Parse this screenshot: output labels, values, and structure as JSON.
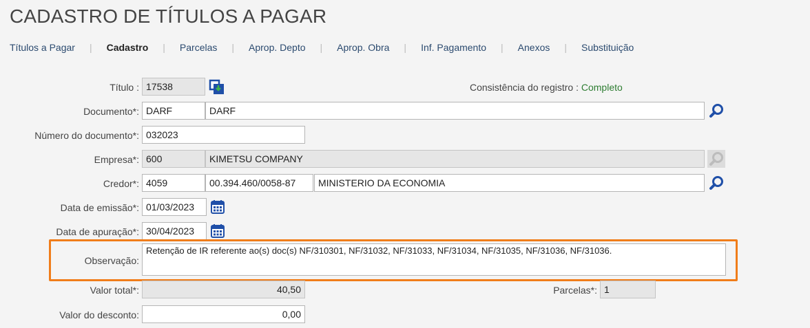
{
  "page": {
    "title": "CADASTRO DE TÍTULOS A PAGAR"
  },
  "tabs": [
    {
      "label": "Títulos a Pagar",
      "active": false
    },
    {
      "label": "Cadastro",
      "active": true
    },
    {
      "label": "Parcelas",
      "active": false
    },
    {
      "label": "Aprop. Depto",
      "active": false
    },
    {
      "label": "Aprop. Obra",
      "active": false
    },
    {
      "label": "Inf. Pagamento",
      "active": false
    },
    {
      "label": "Anexos",
      "active": false
    },
    {
      "label": "Substituição",
      "active": false
    }
  ],
  "tab_separator": "|",
  "form": {
    "titulo": {
      "label": "Título :",
      "value": "17538",
      "icon": "copy-record-icon"
    },
    "consistencia": {
      "label": "Consistência do registro :",
      "value": "Completo"
    },
    "documento": {
      "label": "Documento*:",
      "code": "DARF",
      "description": "DARF",
      "icon": "search-icon"
    },
    "numero_documento": {
      "label": "Número do documento*:",
      "value": "032023"
    },
    "empresa": {
      "label": "Empresa*:",
      "code": "600",
      "name": "KIMETSU COMPANY",
      "icon": "search-icon"
    },
    "credor": {
      "label": "Credor*:",
      "code": "4059",
      "cnpj": "00.394.460/0058-87",
      "name": "MINISTERIO DA ECONOMIA",
      "icon": "search-icon"
    },
    "data_emissao": {
      "label": "Data de emissão*:",
      "value": "01/03/2023",
      "icon": "calendar-icon"
    },
    "data_apuracao": {
      "label": "Data de apuração*:",
      "value": "30/04/2023",
      "icon": "calendar-icon"
    },
    "observacao": {
      "label": "Observação:",
      "value": "Retenção de IR referente ao(s) doc(s) NF/310301, NF/31032, NF/31033, NF/31034, NF/31035, NF/31036, NF/31036."
    },
    "valor_total": {
      "label": "Valor total*:",
      "value": "40,50"
    },
    "parcelas": {
      "label": "Parcelas*:",
      "value": "1"
    },
    "valor_desconto": {
      "label": "Valor do desconto:",
      "value": "0,00"
    }
  },
  "colors": {
    "highlight": "#f07d1a",
    "status_ok": "#2e7d32",
    "icon_blue": "#1f4fa8"
  }
}
